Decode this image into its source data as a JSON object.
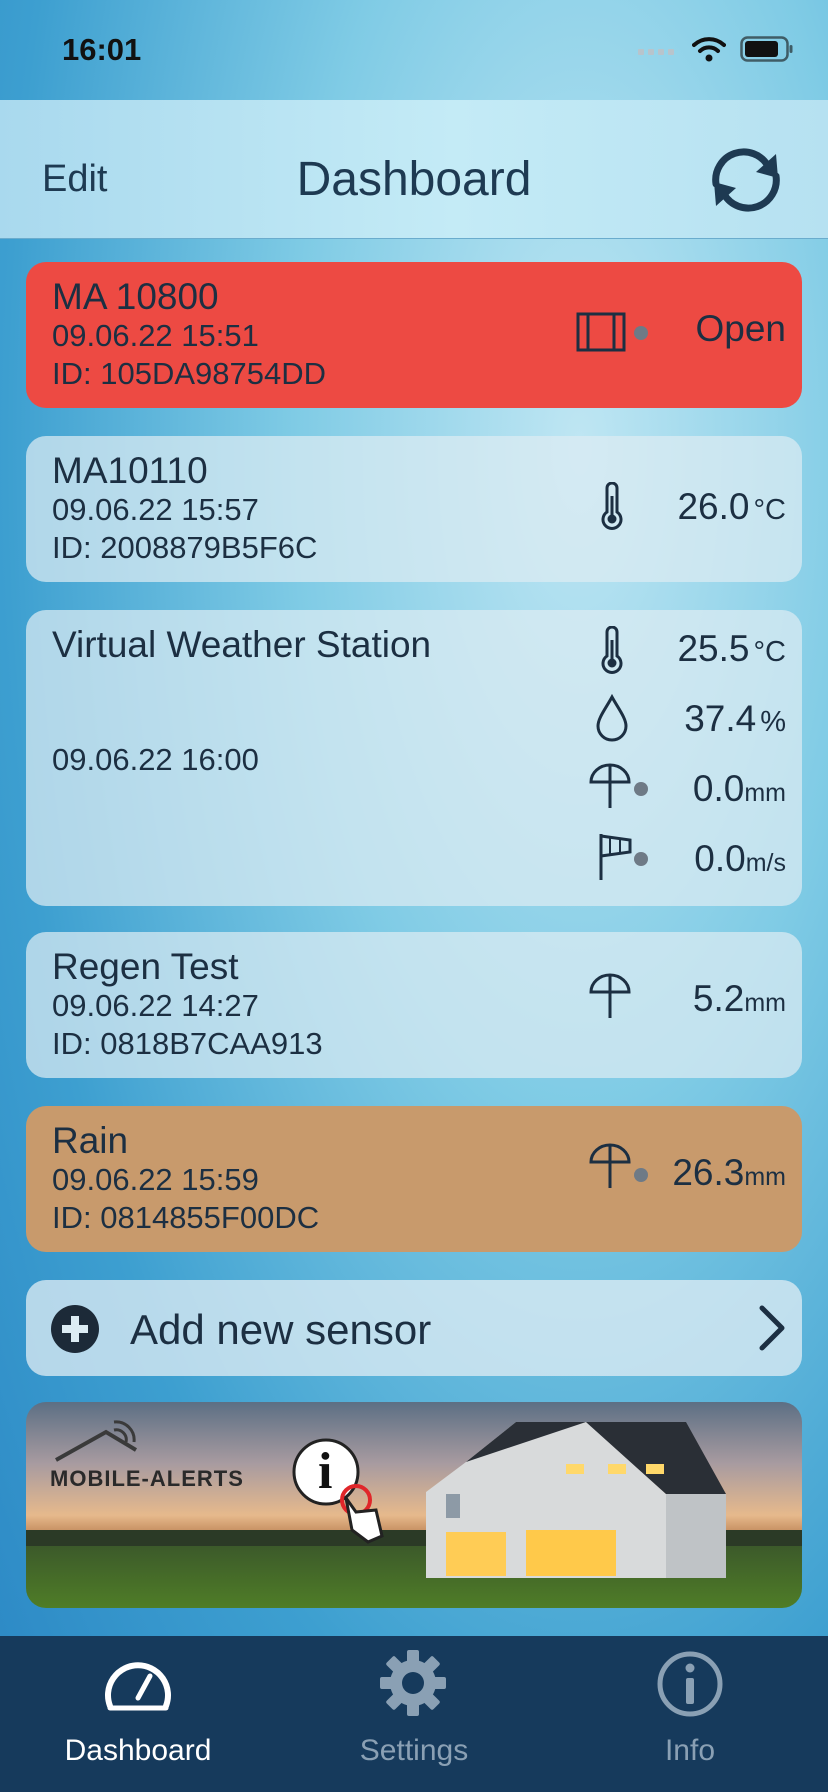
{
  "status_bar": {
    "time": "16:01"
  },
  "nav": {
    "edit_label": "Edit",
    "title": "Dashboard"
  },
  "sensors": [
    {
      "name": "MA 10800",
      "date": "09.06.22   15:51",
      "id": "ID: 105DA98754DD",
      "color": "#ed4a43",
      "readings": [
        {
          "icon": "window-contact-icon",
          "value": "Open",
          "unit": ""
        }
      ]
    },
    {
      "name": "MA10110",
      "date": "09.06.22   15:57",
      "id": "ID: 2008879B5F6C",
      "color": "#dcecf3",
      "readings": [
        {
          "icon": "thermometer-icon",
          "value": "26.0",
          "unit": "°C"
        }
      ]
    },
    {
      "name": "Virtual Weather Station",
      "date": "09.06.22   16:00",
      "color": "#dcecf3",
      "readings": [
        {
          "icon": "thermometer-icon",
          "value": "25.5",
          "unit": "°C"
        },
        {
          "icon": "humidity-drop-icon",
          "value": "37.4",
          "unit": "%"
        },
        {
          "icon": "rain-umbrella-icon",
          "value": "0.0",
          "unit": "mm"
        },
        {
          "icon": "wind-sock-icon",
          "value": "0.0",
          "unit": "m/s"
        }
      ]
    },
    {
      "name": "Regen Test",
      "date": "09.06.22   14:27",
      "id": "ID: 0818B7CAA913",
      "color": "#dcecf3",
      "readings": [
        {
          "icon": "rain-umbrella-icon",
          "value": "5.2",
          "unit": "mm"
        }
      ]
    },
    {
      "name": "Rain",
      "date": "09.06.22   15:59",
      "id": "ID: 0814855F00DC",
      "color": "#c89a6c",
      "readings": [
        {
          "icon": "rain-umbrella-icon",
          "value": "26.3",
          "unit": "mm"
        }
      ]
    }
  ],
  "add_sensor": {
    "label": "Add new sensor"
  },
  "banner": {
    "logo_text": "MOBILE-ALERTS"
  },
  "tabs": [
    {
      "label": "Dashboard",
      "icon": "speedometer-icon",
      "active": true
    },
    {
      "label": "Settings",
      "icon": "gear-icon",
      "active": false
    },
    {
      "label": "Info",
      "icon": "info-icon",
      "active": false
    }
  ]
}
